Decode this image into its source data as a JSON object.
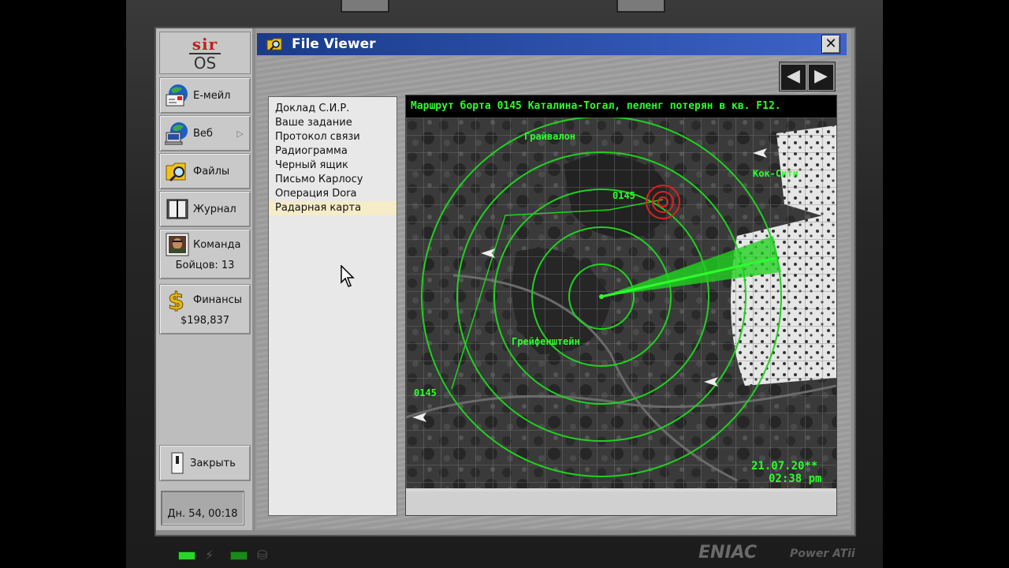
{
  "logo": {
    "top": "sir",
    "bottom": "OS"
  },
  "sidebar": {
    "items": [
      {
        "label": "Е-мейл",
        "icon": "email-icon"
      },
      {
        "label": "Веб",
        "icon": "web-icon",
        "has_submenu": true
      },
      {
        "label": "Файлы",
        "icon": "files-icon"
      },
      {
        "label": "Журнал",
        "icon": "journal-icon"
      }
    ],
    "team": {
      "label": "Команда",
      "value": "Бойцов: 13",
      "icon": "team-avatar-icon"
    },
    "finance": {
      "label": "Финансы",
      "value": "$198,837",
      "icon": "dollar-icon"
    },
    "close": {
      "label": "Закрыть",
      "icon": "close-switch-icon"
    },
    "clock": "Дн. 54, 00:18"
  },
  "window": {
    "title": "File Viewer",
    "close_glyph": "✕",
    "nav": {
      "back": "◀",
      "forward": "▶"
    }
  },
  "files": [
    {
      "label": "Доклад С.И.Р.",
      "selected": false
    },
    {
      "label": "Ваше задание",
      "selected": false
    },
    {
      "label": "Протокол связи",
      "selected": false
    },
    {
      "label": "Радиограмма",
      "selected": false
    },
    {
      "label": "Черный ящик",
      "selected": false
    },
    {
      "label": "Письмо Карлосу",
      "selected": false
    },
    {
      "label": "Операция Dora",
      "selected": false
    },
    {
      "label": "Радарная карта",
      "selected": true
    }
  ],
  "map": {
    "title": "Маршрут борта 0145 Каталина-Тогал, пеленг потерян в кв. F12.",
    "labels": {
      "grayvalon": "Грайвалон",
      "cocity": "Кок-Сити",
      "flight_top": "0145",
      "greifenstein": "Грейфенштейн",
      "flight_bottom": "0145"
    },
    "date": "21.07.20**",
    "time": "02:38 pm",
    "colors": {
      "radar": "#1fd21f",
      "target": "#e02020",
      "title_text": "#2cff2c"
    }
  },
  "bezel": {
    "brand": "ENIAC",
    "model": "Power ATii"
  }
}
